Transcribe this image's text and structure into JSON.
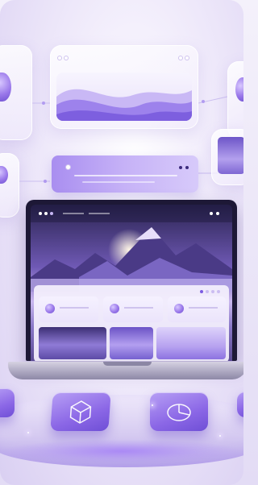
{
  "colors": {
    "accent": "#8b67e6",
    "accent_light": "#c6b2f7",
    "background": "#ece7f8",
    "screen_dark": "#1d1836"
  },
  "icons": {
    "cube": "cube-icon",
    "pie": "pie-chart-icon",
    "wave": "wave-graphic",
    "mountain": "mountain-landscape",
    "sparkle": "sparkle-icon"
  }
}
